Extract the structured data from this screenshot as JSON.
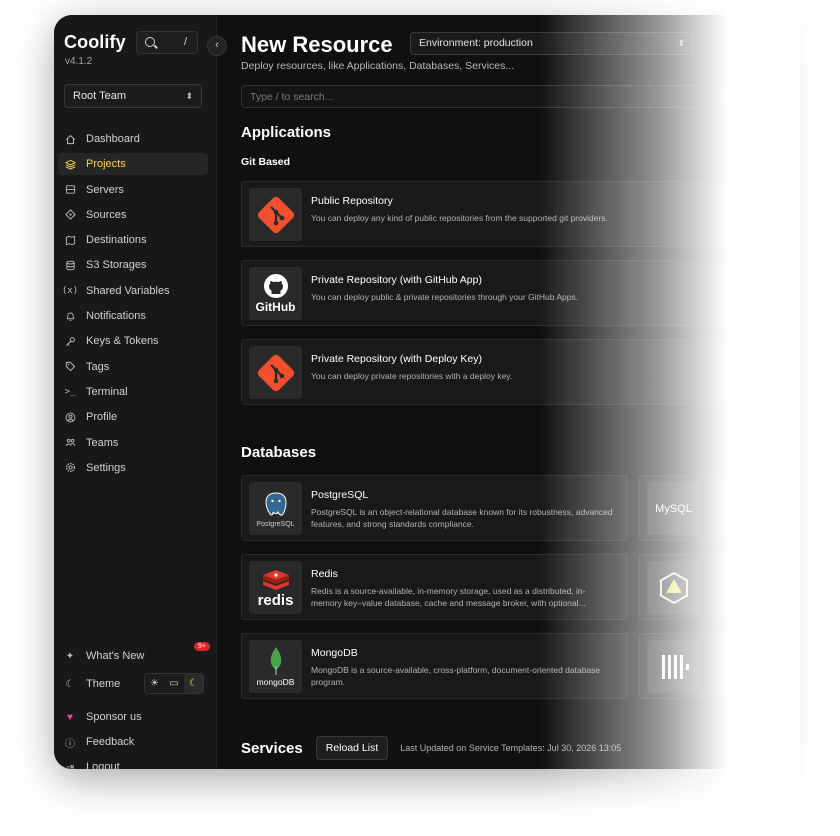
{
  "sidebar": {
    "brand": "Coolify",
    "version": "v4.1.2",
    "search_shortcut": "/",
    "team": "Root Team",
    "nav": [
      {
        "label": "Dashboard",
        "icon": "home-icon"
      },
      {
        "label": "Projects",
        "icon": "layers-icon",
        "active": true
      },
      {
        "label": "Servers",
        "icon": "server-icon"
      },
      {
        "label": "Sources",
        "icon": "git-icon"
      },
      {
        "label": "Destinations",
        "icon": "destination-icon"
      },
      {
        "label": "S3 Storages",
        "icon": "database-icon"
      },
      {
        "label": "Shared Variables",
        "icon": "variables-icon"
      },
      {
        "label": "Notifications",
        "icon": "bell-icon"
      },
      {
        "label": "Keys & Tokens",
        "icon": "key-icon"
      },
      {
        "label": "Tags",
        "icon": "tag-icon"
      },
      {
        "label": "Terminal",
        "icon": "terminal-icon"
      },
      {
        "label": "Profile",
        "icon": "user-icon"
      },
      {
        "label": "Teams",
        "icon": "team-icon"
      },
      {
        "label": "Settings",
        "icon": "gear-icon"
      }
    ],
    "whats_new": "What's New",
    "whats_new_badge": "9+",
    "theme": "Theme",
    "sponsor": "Sponsor us",
    "feedback": "Feedback",
    "logout": "Logout"
  },
  "main": {
    "title": "New Resource",
    "environment": "Environment: production",
    "subtitle": "Deploy resources, like Applications, Databases, Services...",
    "search_placeholder": "Type / to search...",
    "applications": {
      "title": "Applications",
      "group": "Git Based",
      "items": [
        {
          "title": "Public Repository",
          "desc": "You can deploy any kind of public repositories from the supported git providers."
        },
        {
          "title": "Private Repository (with GitHub App)",
          "desc": "You can deploy public & private repositories through your GitHub Apps."
        },
        {
          "title": "Private Repository (with Deploy Key)",
          "desc": "You can deploy private repositories with a deploy key."
        }
      ]
    },
    "databases": {
      "title": "Databases",
      "items": [
        {
          "title": "PostgreSQL",
          "desc": "PostgreSQL is an object-relational database known for its robustness, advanced features, and strong standards compliance.",
          "logo_text": "PostgreSQL"
        },
        {
          "title": "Redis",
          "desc": "Redis is a source-available, in-memory storage, used as a distributed, in-memory key–value database, cache and message broker, with optional...",
          "logo_text": "redis"
        },
        {
          "title": "MongoDB",
          "desc": "MongoDB is a source-available, cross-platform, document-oriented database program.",
          "logo_text": "mongoDB"
        }
      ],
      "right_logos": [
        "MySQL"
      ]
    },
    "services": {
      "title": "Services",
      "reload": "Reload List",
      "last_updated": "Last Updated on Service Templates: Jul 30, 2026 13:05"
    },
    "github_logo_text": "GitHub"
  },
  "colors": {
    "accent": "#fcd34d",
    "git": "#f1502f",
    "badge": "#dc2626",
    "sponsor": "#ec4899"
  }
}
